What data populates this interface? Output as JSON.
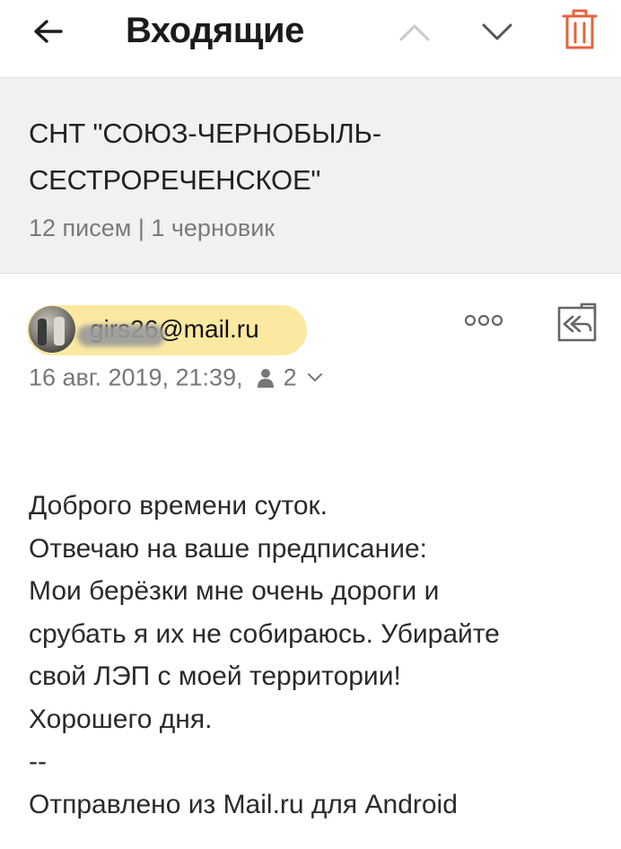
{
  "header": {
    "title": "Входящие",
    "icons": {
      "back": "arrow-left-icon",
      "prev": "chevron-up-icon",
      "next": "chevron-down-icon",
      "delete": "trash-icon"
    },
    "colors": {
      "delete_icon": "#e4633a",
      "chevron_up": "#c8c8c8",
      "chevron_down": "#555555"
    }
  },
  "thread": {
    "subject": "СНТ \"СОЮЗ-ЧЕРНОБЫЛЬ-СЕСТРОРЕЧЕНСКОЕ\"",
    "meta": "12 писем | 1 черновик"
  },
  "message": {
    "sender_email": "girs26@mail.ru",
    "date": "16 авг. 2019, 21:39,",
    "recipients_count": "2",
    "icons": {
      "avatar": "avatar",
      "more": "more-dots-icon",
      "reply_all": "reply-all-icon",
      "recipients": "person-icon",
      "expand": "chevron-down-icon"
    },
    "colors": {
      "sender_pill": "#fbe9a2"
    },
    "body_lines": [
      "Доброго времени суток.",
      "Отвечаю на ваше предписание:",
      "Мои берёзки мне очень дороги и",
      "срубать я их не собираюсь. Убирайте",
      "свой ЛЭП с моей территории!",
      "Хорошего дня.",
      "--",
      "Отправлено из Mail.ru для Android"
    ]
  }
}
